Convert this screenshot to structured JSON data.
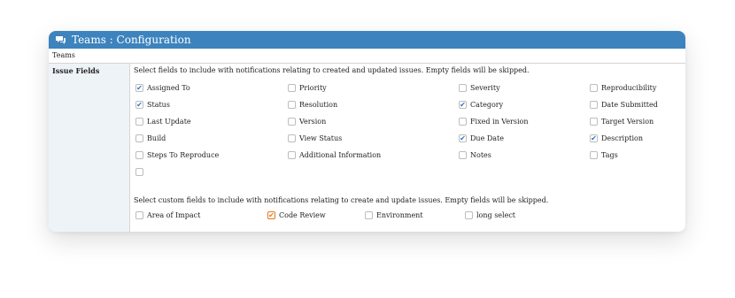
{
  "header": {
    "title": "Teams : Configuration"
  },
  "breadcrumb": "Teams",
  "section": {
    "label": "Issue Fields"
  },
  "issue_fields": {
    "description": "Select fields to include with notifications relating to created and updated issues. Empty fields will be skipped.",
    "rows": [
      [
        {
          "label": "Assigned To",
          "checked": true
        },
        {
          "label": "Priority",
          "checked": false
        },
        {
          "label": "Severity",
          "checked": false
        },
        {
          "label": "Reproducibility",
          "checked": false
        }
      ],
      [
        {
          "label": "Status",
          "checked": true
        },
        {
          "label": "Resolution",
          "checked": false
        },
        {
          "label": "Category",
          "checked": true
        },
        {
          "label": "Date Submitted",
          "checked": false
        }
      ],
      [
        {
          "label": "Last Update",
          "checked": false
        },
        {
          "label": "Version",
          "checked": false
        },
        {
          "label": "Fixed in Version",
          "checked": false
        },
        {
          "label": "Target Version",
          "checked": false
        }
      ],
      [
        {
          "label": "Build",
          "checked": false
        },
        {
          "label": "View Status",
          "checked": false
        },
        {
          "label": "Due Date",
          "checked": true
        },
        {
          "label": "Description",
          "checked": true
        }
      ],
      [
        {
          "label": "Steps To Reproduce",
          "checked": false
        },
        {
          "label": "Additional Information",
          "checked": false
        },
        {
          "label": "Notes",
          "checked": false
        },
        {
          "label": "Tags",
          "checked": false
        }
      ],
      [
        {
          "label": "",
          "checked": false
        }
      ]
    ]
  },
  "custom_fields": {
    "description": "Select custom fields to include with notifications relating to create and update issues. Empty fields will be skipped.",
    "items": [
      {
        "label": "Area of Impact",
        "checked": false
      },
      {
        "label": "Code Review",
        "checked": true
      },
      {
        "label": "Environment",
        "checked": false
      },
      {
        "label": "long select",
        "checked": false
      }
    ]
  },
  "colors": {
    "header": "#3d83bd",
    "check_blue": "#2f74c0",
    "check_orange": "#e07b1a",
    "label_bg": "#eef3f8"
  }
}
